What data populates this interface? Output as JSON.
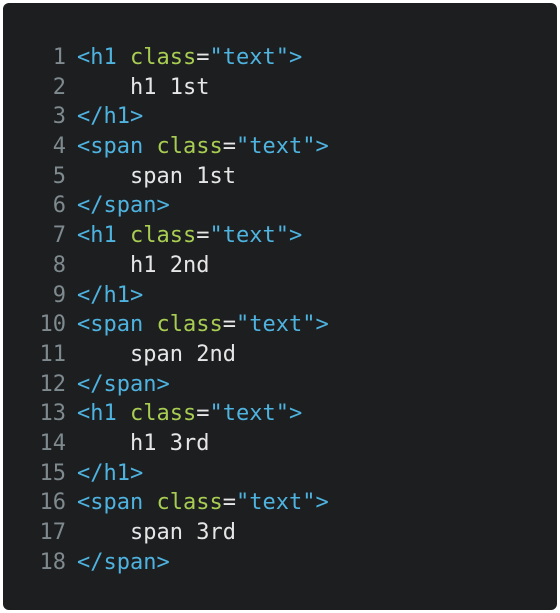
{
  "colors": {
    "background": "#1c1e20",
    "line_number": "#7f8a8f",
    "tag": "#4fb3e0",
    "attribute": "#a8cd52",
    "string": "#4fb3e0",
    "text": "#e6e6e6"
  },
  "lines": [
    {
      "num": "1",
      "tokens": [
        {
          "t": "tag",
          "v": "<h1 "
        },
        {
          "t": "attr",
          "v": "class"
        },
        {
          "t": "op",
          "v": "="
        },
        {
          "t": "str",
          "v": "\"text\""
        },
        {
          "t": "tag",
          "v": ">"
        }
      ]
    },
    {
      "num": "2",
      "tokens": [
        {
          "t": "text",
          "v": "    h1 1st"
        }
      ]
    },
    {
      "num": "3",
      "tokens": [
        {
          "t": "tag",
          "v": "</h1>"
        }
      ]
    },
    {
      "num": "4",
      "tokens": [
        {
          "t": "tag",
          "v": "<span "
        },
        {
          "t": "attr",
          "v": "class"
        },
        {
          "t": "op",
          "v": "="
        },
        {
          "t": "str",
          "v": "\"text\""
        },
        {
          "t": "tag",
          "v": ">"
        }
      ]
    },
    {
      "num": "5",
      "tokens": [
        {
          "t": "text",
          "v": "    span 1st"
        }
      ]
    },
    {
      "num": "6",
      "tokens": [
        {
          "t": "tag",
          "v": "</span>"
        }
      ]
    },
    {
      "num": "7",
      "tokens": [
        {
          "t": "tag",
          "v": "<h1 "
        },
        {
          "t": "attr",
          "v": "class"
        },
        {
          "t": "op",
          "v": "="
        },
        {
          "t": "str",
          "v": "\"text\""
        },
        {
          "t": "tag",
          "v": ">"
        }
      ]
    },
    {
      "num": "8",
      "tokens": [
        {
          "t": "text",
          "v": "    h1 2nd"
        }
      ]
    },
    {
      "num": "9",
      "tokens": [
        {
          "t": "tag",
          "v": "</h1>"
        }
      ]
    },
    {
      "num": "10",
      "tokens": [
        {
          "t": "tag",
          "v": "<span "
        },
        {
          "t": "attr",
          "v": "class"
        },
        {
          "t": "op",
          "v": "="
        },
        {
          "t": "str",
          "v": "\"text\""
        },
        {
          "t": "tag",
          "v": ">"
        }
      ]
    },
    {
      "num": "11",
      "tokens": [
        {
          "t": "text",
          "v": "    span 2nd"
        }
      ]
    },
    {
      "num": "12",
      "tokens": [
        {
          "t": "tag",
          "v": "</span>"
        }
      ]
    },
    {
      "num": "13",
      "tokens": [
        {
          "t": "tag",
          "v": "<h1 "
        },
        {
          "t": "attr",
          "v": "class"
        },
        {
          "t": "op",
          "v": "="
        },
        {
          "t": "str",
          "v": "\"text\""
        },
        {
          "t": "tag",
          "v": ">"
        }
      ]
    },
    {
      "num": "14",
      "tokens": [
        {
          "t": "text",
          "v": "    h1 3rd"
        }
      ]
    },
    {
      "num": "15",
      "tokens": [
        {
          "t": "tag",
          "v": "</h1>"
        }
      ]
    },
    {
      "num": "16",
      "tokens": [
        {
          "t": "tag",
          "v": "<span "
        },
        {
          "t": "attr",
          "v": "class"
        },
        {
          "t": "op",
          "v": "="
        },
        {
          "t": "str",
          "v": "\"text\""
        },
        {
          "t": "tag",
          "v": ">"
        }
      ]
    },
    {
      "num": "17",
      "tokens": [
        {
          "t": "text",
          "v": "    span 3rd"
        }
      ]
    },
    {
      "num": "18",
      "tokens": [
        {
          "t": "tag",
          "v": "</span>"
        }
      ]
    }
  ]
}
